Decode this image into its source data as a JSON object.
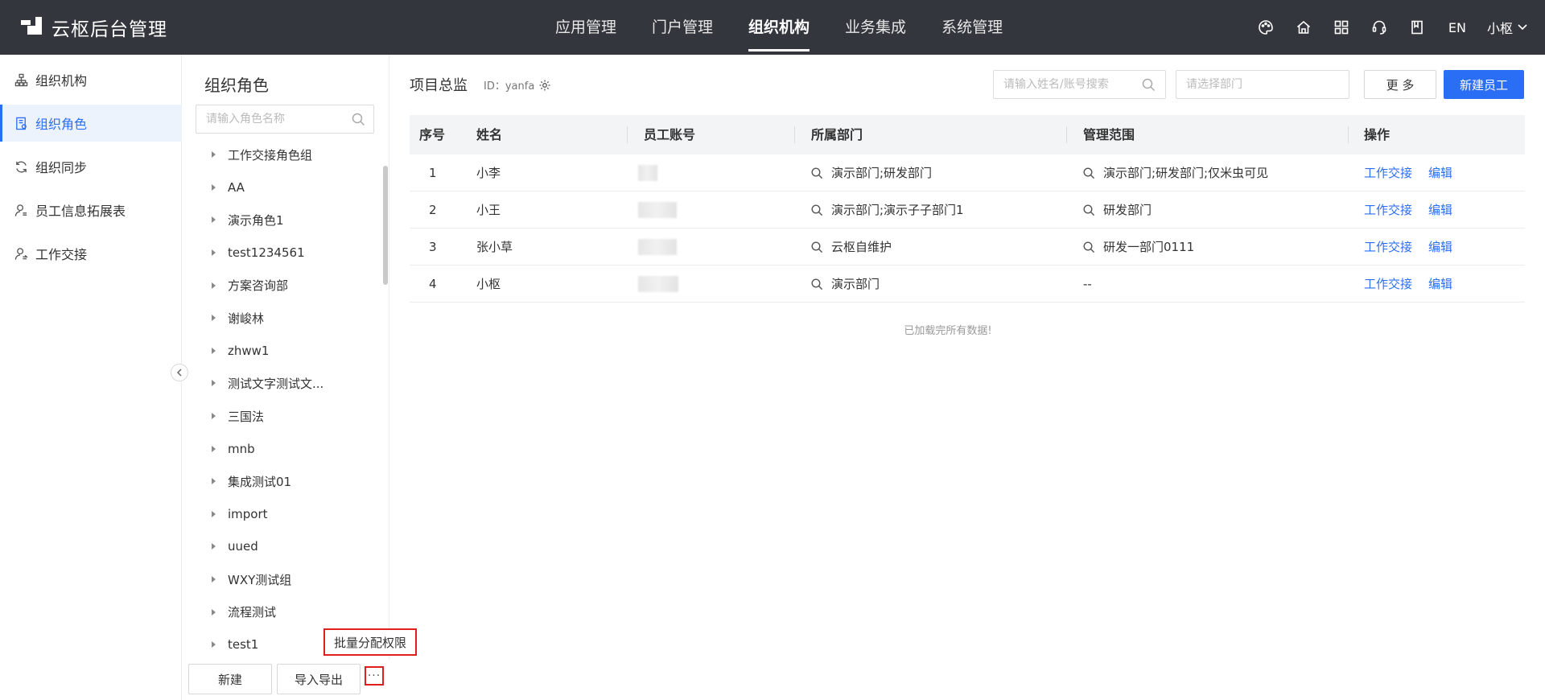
{
  "app": {
    "title": "云枢后台管理"
  },
  "topnav": {
    "items": [
      {
        "label": "应用管理",
        "active": false
      },
      {
        "label": "门户管理",
        "active": false
      },
      {
        "label": "组织机构",
        "active": true
      },
      {
        "label": "业务集成",
        "active": false
      },
      {
        "label": "系统管理",
        "active": false
      }
    ],
    "icons": [
      "palette-icon",
      "home-icon",
      "apps-grid-icon",
      "headset-icon",
      "book-icon"
    ],
    "lang": "EN",
    "user": "小枢"
  },
  "sidebar": {
    "items": [
      {
        "label": "组织机构",
        "icon": "org-tree-icon",
        "active": false
      },
      {
        "label": "组织角色",
        "icon": "role-doc-icon",
        "active": true
      },
      {
        "label": "组织同步",
        "icon": "sync-icon",
        "active": false
      },
      {
        "label": "员工信息拓展表",
        "icon": "user-info-icon",
        "active": false
      },
      {
        "label": "工作交接",
        "icon": "handover-icon",
        "active": false
      }
    ]
  },
  "rolepanel": {
    "title": "组织角色",
    "search_placeholder": "请输入角色名称",
    "roles": [
      "工作交接角色组",
      "AA",
      "演示角色1",
      "test1234561",
      "方案咨询部",
      "谢峻林",
      "zhww1",
      "测试文字测试文...",
      "三国法",
      "mnb",
      "集成测试01",
      "import",
      "uued",
      "WXY测试组",
      "流程测试",
      "test1"
    ],
    "new_label": "新建",
    "import_export_label": "导入导出",
    "more_label": "···",
    "batch_label": "批量分配权限"
  },
  "main": {
    "title": "项目总监",
    "id_text": "ID：yanfa",
    "search_placeholder": "请输入姓名/账号搜索",
    "dept_placeholder": "请选择部门",
    "more_label": "更 多",
    "new_employee_label": "新建员工",
    "columns": [
      "序号",
      "姓名",
      "员工账号",
      "所属部门",
      "管理范围",
      "操作"
    ],
    "rows": [
      {
        "index": "1",
        "name": "小李",
        "dept": "演示部门;研发部门",
        "scope": "演示部门;研发部门;仅米虫可见",
        "scope_icon": true
      },
      {
        "index": "2",
        "name": "小王",
        "dept": "演示部门;演示子子部门1",
        "scope": "研发部门",
        "scope_icon": true
      },
      {
        "index": "3",
        "name": "张小草",
        "dept": "云枢自维护",
        "scope": "研发一部门0111",
        "scope_icon": true
      },
      {
        "index": "4",
        "name": "小枢",
        "dept": "演示部门",
        "scope": "--",
        "scope_icon": false
      }
    ],
    "action_handover": "工作交接",
    "action_edit": "编辑",
    "loaded_text": "已加载完所有数据!"
  }
}
